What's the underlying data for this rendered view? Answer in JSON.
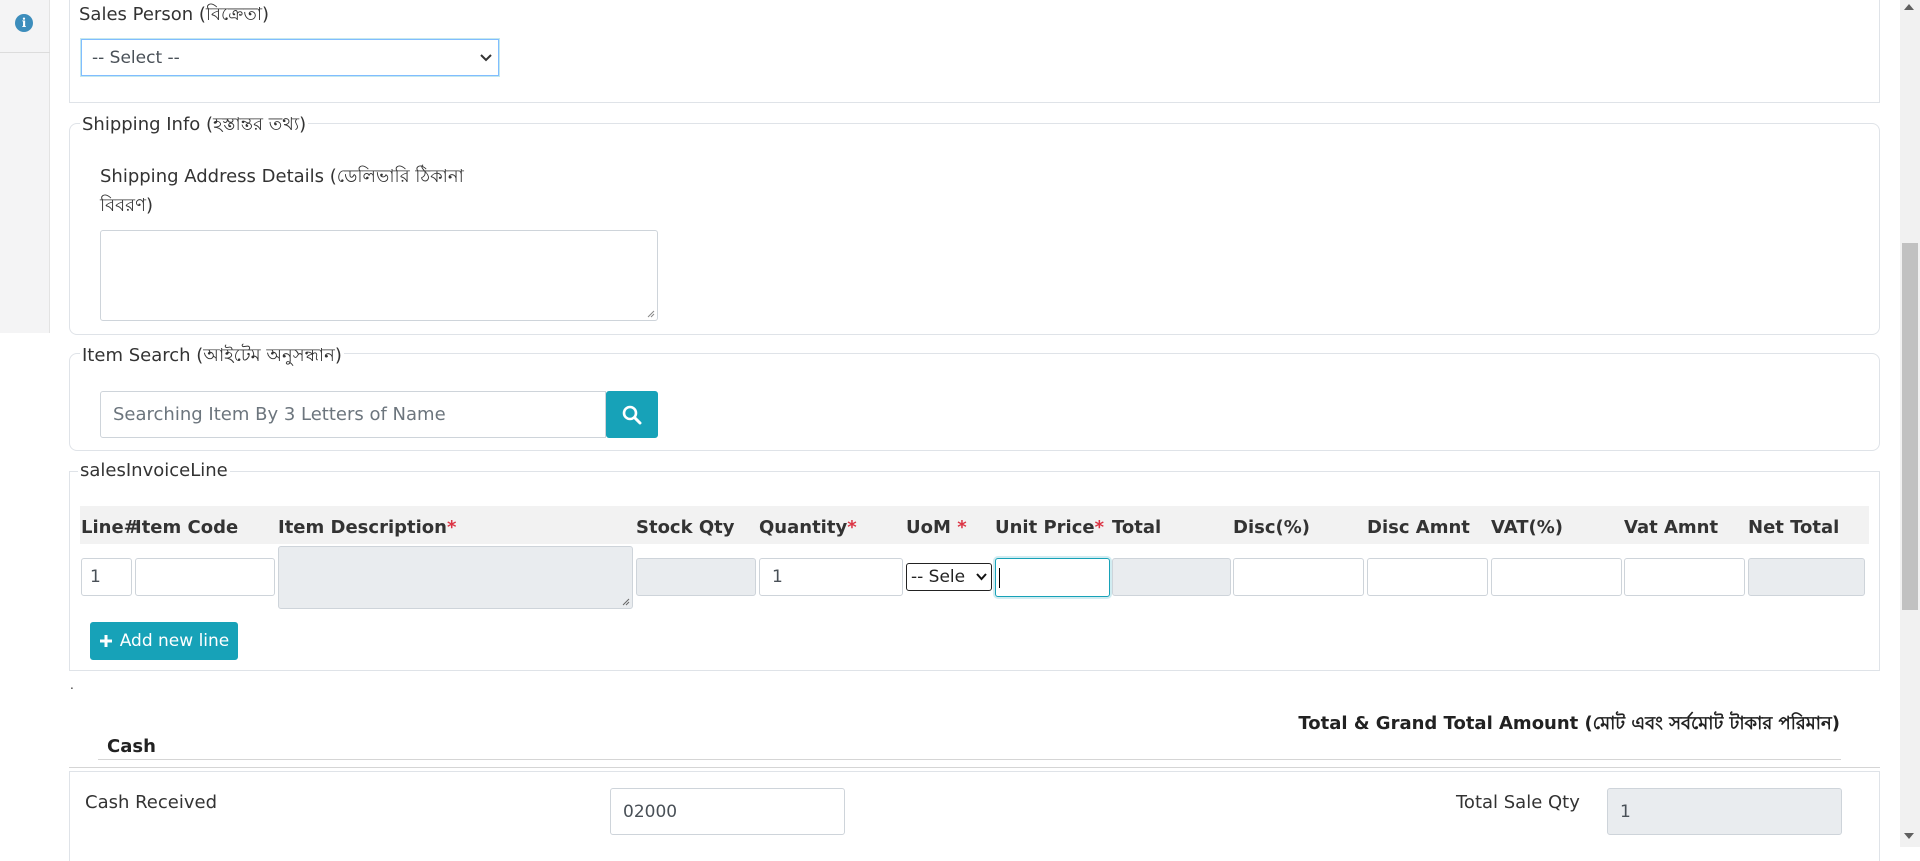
{
  "sidebar": {
    "info_icon_glyph": "i"
  },
  "sales_person": {
    "label": "Sales Person (বিক্রেতা)",
    "selected": "-- Select --"
  },
  "shipping": {
    "legend": "Shipping Info (হস্তান্তর তথ্য)",
    "address_label_line1": "Shipping Address Details (ডেলিভারি ঠিকানা",
    "address_label_line2": "বিবরণ)",
    "address_value": ""
  },
  "item_search": {
    "legend": "Item Search (আইটেম অনুসন্ধান)",
    "placeholder": "Searching Item By 3 Letters of Name"
  },
  "invoice_lines": {
    "legend": "salesInvoiceLine",
    "headers": {
      "line_no": "Line#",
      "item_code": "Item Code",
      "item_description": "Item Description",
      "stock_qty": "Stock Qty",
      "quantity": "Quantity",
      "uom": "UoM",
      "unit_price": "Unit Price",
      "total": "Total",
      "disc_pct": "Disc(%)",
      "disc_amnt": "Disc Amnt",
      "vat_pct": "VAT(%)",
      "vat_amnt": "Vat Amnt",
      "net_total": "Net Total"
    },
    "required_mark": "*",
    "rows": [
      {
        "line_no": "1",
        "item_code": "",
        "item_description": "",
        "stock_qty": "",
        "quantity": "1",
        "uom": "-- Sele",
        "unit_price": "",
        "total": "",
        "disc_pct": "",
        "disc_amnt": "",
        "vat_pct": "",
        "vat_amnt": "",
        "net_total": ""
      }
    ],
    "add_line_label": "Add new line"
  },
  "totals": {
    "dot": ".",
    "title": "Total & Grand Total Amount (মোট এবং সর্বমোট টাকার পরিমান)",
    "cash_heading": "Cash",
    "cash_received_label": "Cash Received",
    "cash_received_value": "02000",
    "total_sale_qty_label": "Total Sale Qty",
    "total_sale_qty_value": "1"
  },
  "colors": {
    "accent_teal": "#17a2b8",
    "info_blue": "#3c8dbc",
    "required_red": "#dc3545",
    "readonly_gray": "#e9ecef"
  }
}
